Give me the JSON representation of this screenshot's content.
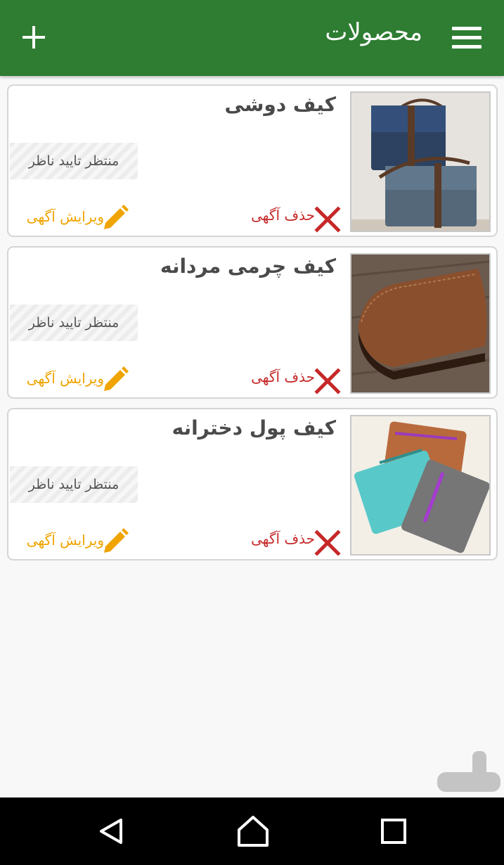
{
  "appbar": {
    "title": "محصولات",
    "menu_icon": "menu-icon",
    "add_icon": "add-icon",
    "color": "#2e7d32"
  },
  "products": [
    {
      "title": "کیف دوشی",
      "status": "منتظر تایید ناظر",
      "delete_label": "حذف آگهی",
      "edit_label": "ویرایش آگهی",
      "image": "blue canvas shoulder bags"
    },
    {
      "title": "کیف چرمی مردانه",
      "status": "منتظر تایید ناظر",
      "delete_label": "حذف آگهی",
      "edit_label": "ویرایش آگهی",
      "image": "brown leather wallet"
    },
    {
      "title": "کیف پول دخترانه",
      "status": "منتظر تایید ناظر",
      "delete_label": "حذف آگهی",
      "edit_label": "ویرایش آگهی",
      "image": "colorful felt zip wallets"
    }
  ],
  "colors": {
    "delete": "#c62828",
    "edit": "#f0a400"
  },
  "navbar": {
    "back_icon": "back-icon",
    "home_icon": "home-icon",
    "recents_icon": "recents-icon"
  }
}
